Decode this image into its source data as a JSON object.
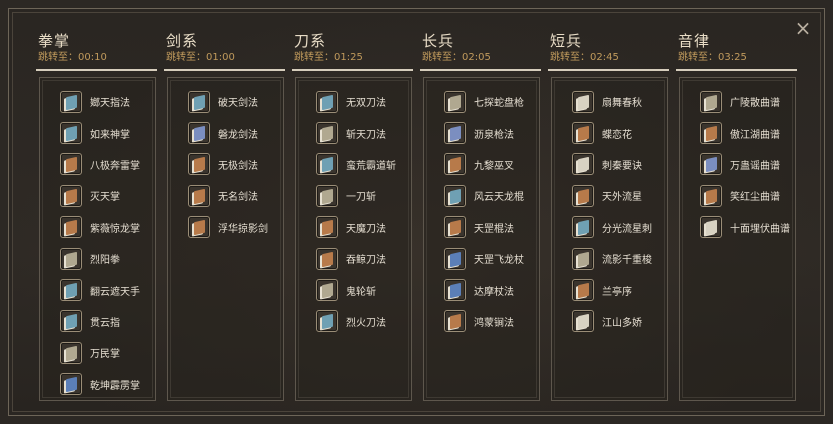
{
  "close_icon": "×",
  "columns": [
    {
      "title": "拳掌",
      "jump_prefix": "跳转至：",
      "jump_time": "00:10",
      "items": [
        {
          "label": "嫏天指法",
          "color": "#6fa0b3"
        },
        {
          "label": "如来神掌",
          "color": "#6fa0b3"
        },
        {
          "label": "八极奔雷掌",
          "color": "#b77a4a"
        },
        {
          "label": "灭天掌",
          "color": "#b77a4a"
        },
        {
          "label": "紫薇惊龙掌",
          "color": "#b77a4a"
        },
        {
          "label": "烈阳拳",
          "color": "#b0a890"
        },
        {
          "label": "翻云遮天手",
          "color": "#6fa0b3"
        },
        {
          "label": "贯云指",
          "color": "#6fa0b3"
        },
        {
          "label": "万民掌",
          "color": "#b0a890"
        },
        {
          "label": "乾坤霹雳掌",
          "color": "#5b7fb8"
        }
      ]
    },
    {
      "title": "剑系",
      "jump_prefix": "跳转至：",
      "jump_time": "01:00",
      "items": [
        {
          "label": "破天剑法",
          "color": "#6fa0b3"
        },
        {
          "label": "磐龙剑法",
          "color": "#7b8ec0"
        },
        {
          "label": "无极剑法",
          "color": "#b77a4a"
        },
        {
          "label": "无名剑法",
          "color": "#b77a4a"
        },
        {
          "label": "浮华掠影剑",
          "color": "#b77a4a"
        }
      ]
    },
    {
      "title": "刀系",
      "jump_prefix": "跳转至：",
      "jump_time": "01:25",
      "items": [
        {
          "label": "无双刀法",
          "color": "#6fa0b3"
        },
        {
          "label": "斩天刀法",
          "color": "#b0a890"
        },
        {
          "label": "蛮荒霸道斩",
          "color": "#6fa0b3"
        },
        {
          "label": "一刀斩",
          "color": "#b0a890"
        },
        {
          "label": "天魔刀法",
          "color": "#b77a4a"
        },
        {
          "label": "吞鲸刀法",
          "color": "#b77a4a"
        },
        {
          "label": "鬼轮斩",
          "color": "#b0a890"
        },
        {
          "label": "烈火刀法",
          "color": "#6fa0b3"
        }
      ]
    },
    {
      "title": "长兵",
      "jump_prefix": "跳转至：",
      "jump_time": "02:05",
      "items": [
        {
          "label": "七探蛇盘枪",
          "color": "#b0a890"
        },
        {
          "label": "沥泉枪法",
          "color": "#7b8ec0"
        },
        {
          "label": "九黎巫叉",
          "color": "#b77a4a"
        },
        {
          "label": "风云天龙棍",
          "color": "#6fa0b3"
        },
        {
          "label": "天罡棍法",
          "color": "#b77a4a"
        },
        {
          "label": "天罡飞龙杖",
          "color": "#5b7fb8"
        },
        {
          "label": "达摩杖法",
          "color": "#5b7fb8"
        },
        {
          "label": "鸿蒙锏法",
          "color": "#b77a4a"
        }
      ]
    },
    {
      "title": "短兵",
      "jump_prefix": "跳转至：",
      "jump_time": "02:45",
      "items": [
        {
          "label": "扇舞春秋",
          "color": "#d8d2c2"
        },
        {
          "label": "蝶恋花",
          "color": "#b77a4a"
        },
        {
          "label": "刺秦要诀",
          "color": "#d8d2c2"
        },
        {
          "label": "天外流星",
          "color": "#b77a4a"
        },
        {
          "label": "分光流星刺",
          "color": "#6fa0b3"
        },
        {
          "label": "流影千重梭",
          "color": "#b0a890"
        },
        {
          "label": "兰亭序",
          "color": "#b77a4a"
        },
        {
          "label": "江山多娇",
          "color": "#d8d2c2"
        }
      ]
    },
    {
      "title": "音律",
      "jump_prefix": "跳转至：",
      "jump_time": "03:25",
      "items": [
        {
          "label": "广陵散曲谱",
          "color": "#b0a890"
        },
        {
          "label": "傲江湖曲谱",
          "color": "#b77a4a"
        },
        {
          "label": "万蛊谣曲谱",
          "color": "#7b8ec0"
        },
        {
          "label": "笑红尘曲谱",
          "color": "#b77a4a"
        },
        {
          "label": "十面埋伏曲谱",
          "color": "#d8d2c2"
        }
      ]
    }
  ]
}
